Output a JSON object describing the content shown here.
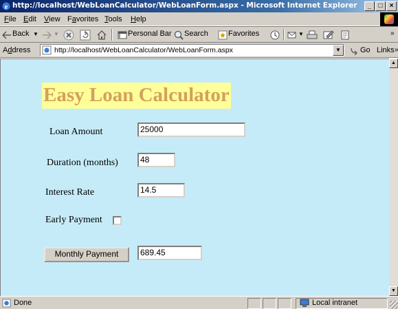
{
  "window": {
    "title": "http://localhost/WebLoanCalculator/WebLoanForm.aspx - Microsoft Internet Explorer",
    "controls": [
      "_",
      "□",
      "×"
    ]
  },
  "menu": {
    "items": [
      {
        "key": "F",
        "rest": "ile"
      },
      {
        "key": "E",
        "rest": "dit"
      },
      {
        "key": "V",
        "rest": "iew"
      },
      {
        "pre": "F",
        "key": "a",
        "rest": "vorites"
      },
      {
        "key": "T",
        "rest": "ools"
      },
      {
        "key": "H",
        "rest": "elp"
      }
    ]
  },
  "toolbar": {
    "back": "Back",
    "personal_bar": "Personal Bar",
    "search": "Search",
    "favorites": "Favorites"
  },
  "address": {
    "label_pre": "A",
    "label_key": "d",
    "label_rest": "dress",
    "url": "http://localhost/WebLoanCalculator/WebLoanForm.aspx",
    "go": "Go",
    "links": "Links"
  },
  "page": {
    "heading": "Easy Loan Calculator",
    "loan_amount_label": "Loan Amount",
    "loan_amount_value": "25000",
    "duration_label": "Duration (months)",
    "duration_value": "48",
    "interest_label": "Interest Rate",
    "interest_value": "14.5",
    "early_payment_label": "Early Payment",
    "early_payment_checked": false,
    "monthly_payment_button": "Monthly Payment",
    "monthly_payment_value": "689.45"
  },
  "status": {
    "text": "Done",
    "zone": "Local intranet"
  }
}
